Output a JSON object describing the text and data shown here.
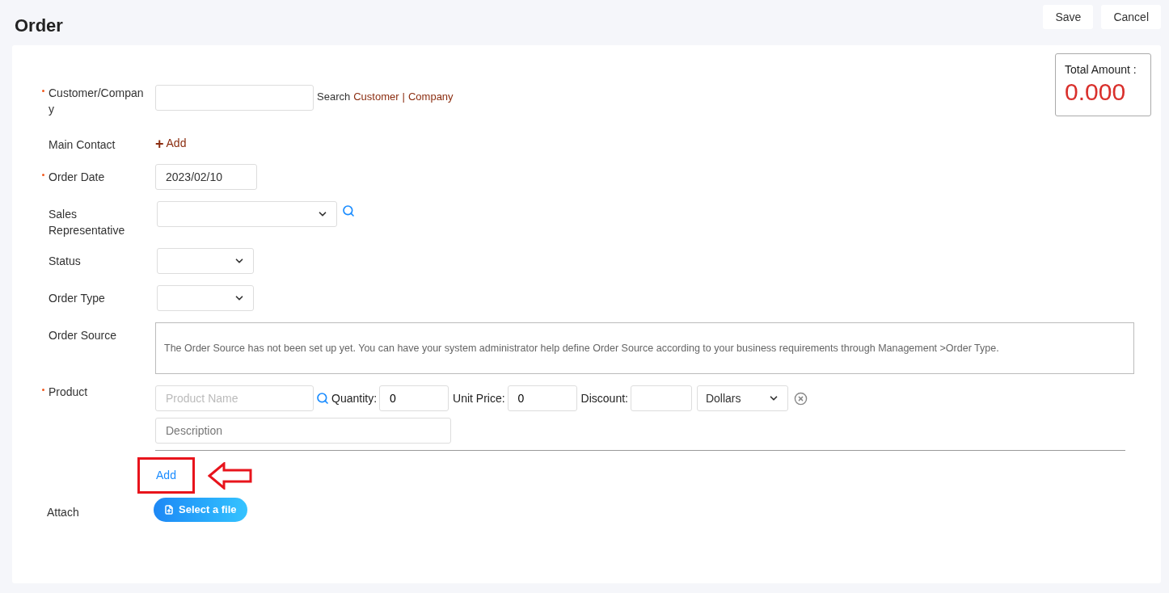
{
  "page": {
    "title": "Order"
  },
  "actions": [
    {
      "label": "Save"
    },
    {
      "label": "Cancel"
    }
  ],
  "total": {
    "label": "Total Amount :",
    "value": "0.000"
  },
  "customer": {
    "label": "Customer/Company",
    "required": true,
    "search_label": "Search",
    "links": [
      "Customer",
      "Company"
    ],
    "separator": "|"
  },
  "main_contact": {
    "label": "Main Contact",
    "required": false,
    "add_icon": "+",
    "add_label": "Add"
  },
  "order_date": {
    "label": "Order Date",
    "required": true,
    "value": "2023/02/10"
  },
  "sales_rep": {
    "label": "Sales Representative",
    "required": false
  },
  "status": {
    "label": "Status",
    "required": false
  },
  "order_type": {
    "label": "Order Type",
    "required": false
  },
  "order_source": {
    "label": "Order Source",
    "required": false,
    "message": "The Order Source has not been set up yet. You can have your system administrator help define Order Source according to your business requirements through Management >Order Type."
  },
  "product": {
    "label": "Product",
    "required": true,
    "name_placeholder": "Product Name",
    "quantity_label": "Quantity:",
    "quantity": "0",
    "unit_price_label": "Unit Price:",
    "unit_price": "0",
    "discount_label": "Discount:",
    "discount_unit": "Dollars",
    "description_placeholder": "Description",
    "add_label": "Add"
  },
  "attach": {
    "label": "Attach",
    "button": "Select a file"
  }
}
